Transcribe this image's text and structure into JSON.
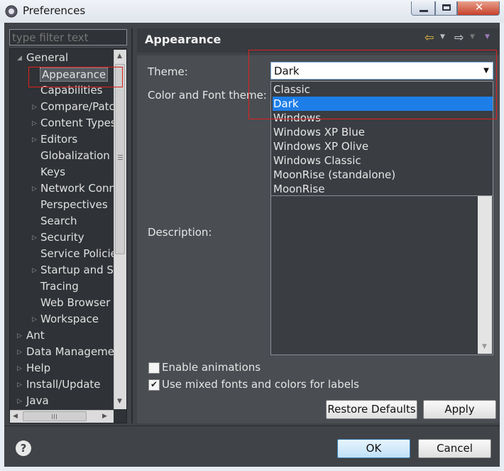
{
  "window": {
    "title": "Preferences"
  },
  "filter": {
    "placeholder": "type filter text"
  },
  "tree": {
    "general": "General",
    "general_children": [
      "Appearance",
      "Capabilities",
      "Compare/Patc",
      "Content Types",
      "Editors",
      "Globalization",
      "Keys",
      "Network Conn",
      "Perspectives",
      "Search",
      "Security",
      "Service Policie",
      "Startup and Sh",
      "Tracing",
      "Web Browser",
      "Workspace"
    ],
    "top_level": [
      "Ant",
      "Data Managemen",
      "Help",
      "Install/Update",
      "Java"
    ],
    "selected": "Appearance"
  },
  "page": {
    "title": "Appearance",
    "theme_label": "Theme:",
    "color_font_label": "Color and Font theme:",
    "description_label": "Description:",
    "theme_value": "Dark",
    "theme_options": [
      "Classic",
      "Dark",
      "Windows",
      "Windows XP Blue",
      "Windows XP Olive",
      "Windows Classic",
      "MoonRise (standalone)",
      "MoonRise"
    ],
    "enable_animations": "Enable animations",
    "mixed_fonts": "Use mixed fonts and colors for labels",
    "restore_defaults": "Restore Defaults",
    "apply": "Apply"
  },
  "footer": {
    "ok": "OK",
    "cancel": "Cancel"
  },
  "colors": {
    "selection": "#1e7ee8",
    "highlight": "#e02020",
    "background": "#4a4d52"
  }
}
